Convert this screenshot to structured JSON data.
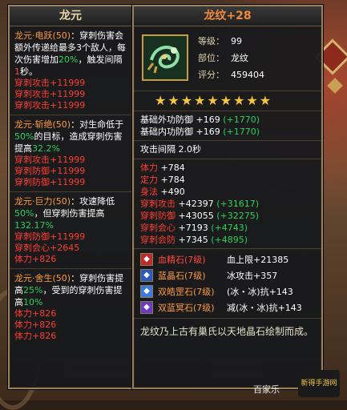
{
  "left": {
    "title": "龙元",
    "skills": [
      {
        "name": "龙元·电跃",
        "level": "(50)",
        "desc_a": "：穿刺伤害会额外传递给最多3个敌人，每次伤害增加",
        "pct1": "20%",
        "desc_b": "，触发间隔",
        "interval": "1",
        "desc_c": "秒。",
        "stats": [
          "穿刺攻击+11999",
          "穿刺攻击+11999",
          "穿刺攻击+11999"
        ]
      },
      {
        "name": "龙元·斩绝",
        "level": "(50)",
        "desc_a": "：对生命低于",
        "pct1": "50%",
        "desc_b": "的目标，造成穿刺伤害提高",
        "pct2": "32.2%",
        "stats": [
          "穿刺攻击+11999",
          "穿刺防御+11999",
          "穿刺防御+11999"
        ]
      },
      {
        "name": "龙元·巨力",
        "level": "(50)",
        "desc_a": "：攻速降低",
        "pct1": "50%",
        "desc_b": "，但穿刺伤害提高",
        "pct2": "132.17%",
        "stats": [
          "穿刺防御+11999",
          "穿刺会心+2645",
          "体力+826"
        ]
      },
      {
        "name": "龙元·舍生",
        "level": "(50)",
        "desc_a": "：穿刺伤害提高",
        "pct1": "25%",
        "desc_b": "，受到的穿刺伤害提高",
        "pct2": "10%",
        "stats": [
          "体力+826",
          "体力+826",
          "体力+826"
        ]
      }
    ]
  },
  "right": {
    "title": "龙纹",
    "title_plus": "+28",
    "level_label": "等级：",
    "level": "99",
    "slot_label": "部位：",
    "slot": "龙纹",
    "score_label": "评分：",
    "score": "459404",
    "star_count": 9,
    "base": [
      {
        "label": "基础外功防御",
        "value": " +169",
        "bonus": " (+1770)"
      },
      {
        "label": "基础内功防御",
        "value": " +169",
        "bonus": " (+1770)"
      }
    ],
    "attack_interval": "攻击间隔 2.0秒",
    "attrs": [
      {
        "label": "体力",
        "value": " +784",
        "bonus": ""
      },
      {
        "label": "定力",
        "value": " +784",
        "bonus": ""
      },
      {
        "label": "身法",
        "value": " +490",
        "bonus": ""
      },
      {
        "label": "穿刺攻击",
        "value": " +42397",
        "bonus": " (+31617)"
      },
      {
        "label": "穿刺防御",
        "value": " +43055",
        "bonus": " (+32275)"
      },
      {
        "label": "穿刺会心",
        "value": " +7193",
        "bonus": " (+4743)"
      },
      {
        "label": "穿刺会防",
        "value": " +7345",
        "bonus": " (+4895)"
      }
    ],
    "gems": [
      {
        "name": "血精石",
        "level": "(7级)",
        "effect": "血上限+21385",
        "color": "#ff4a3a"
      },
      {
        "name": "蓝晶石",
        "level": "(7级)",
        "effect": "冰攻击+357",
        "color": "#ff9a3c"
      },
      {
        "name": "双皓罡石",
        "level": "(7级)",
        "effect": "(冰・冰)抗+143",
        "color": "#ff9a3c"
      },
      {
        "name": "双蓝冥石",
        "level": "(7级)",
        "effect": "减(冰・冰)抗+143",
        "color": "#ff9a3c"
      }
    ],
    "lore": "龙纹乃上古有巢氏以天地晶石绘制而成。"
  },
  "watermark": "百家乐",
  "logo_text": "新得手游网"
}
